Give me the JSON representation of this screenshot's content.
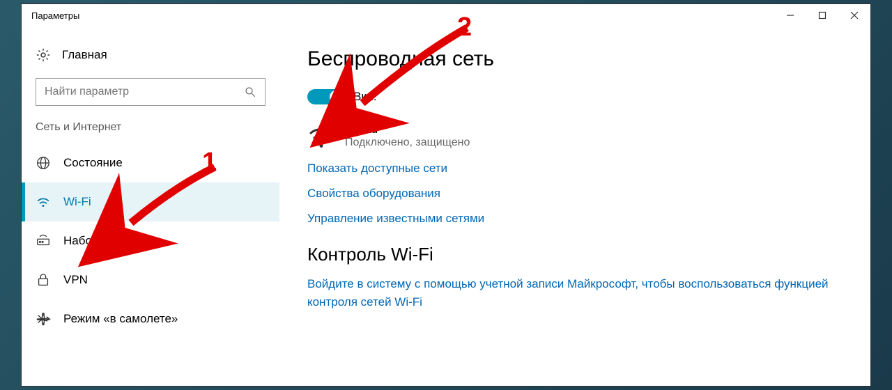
{
  "window": {
    "title": "Параметры"
  },
  "sidebar": {
    "home_label": "Главная",
    "search_placeholder": "Найти параметр",
    "section_label": "Сеть и Интернет",
    "items": [
      {
        "label": "Состояние"
      },
      {
        "label": "Wi-Fi"
      },
      {
        "label": "Набор номера"
      },
      {
        "label": "VPN"
      },
      {
        "label": "Режим «в самолете»"
      }
    ]
  },
  "main": {
    "heading": "Беспроводная сеть",
    "toggle_label": "Вкл.",
    "network": {
      "name": "Ku-Ku",
      "status": "Подключено, защищено"
    },
    "links": {
      "show_networks": "Показать доступные сети",
      "hw_props": "Свойства оборудования",
      "manage_known": "Управление известными сетями"
    },
    "section2_heading": "Контроль Wi-Fi",
    "section2_body": "Войдите в систему с помощью учетной записи Майкрософт, чтобы воспользоваться функцией контроля сетей Wi-Fi"
  },
  "annotations": {
    "num1": "1",
    "num2": "2"
  }
}
